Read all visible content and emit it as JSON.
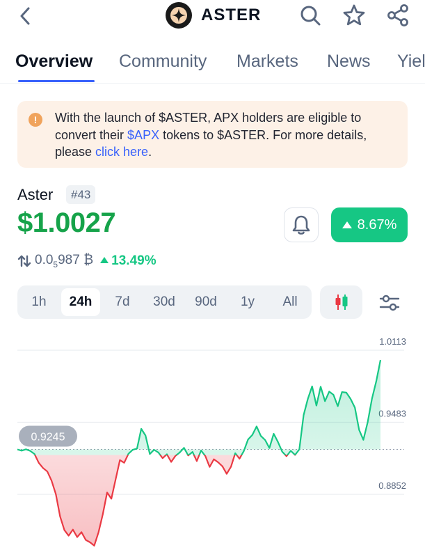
{
  "header": {
    "title": "ASTER",
    "icons": {
      "back": "chevron-left-icon",
      "search": "search-icon",
      "favorite": "star-icon",
      "share": "share-icon"
    }
  },
  "tabs": [
    "Overview",
    "Community",
    "Markets",
    "News",
    "Yiel"
  ],
  "notice": {
    "text_1": "With the launch of $ASTER, APX holders are eligible to convert their ",
    "apx_link": "$APX",
    "text_2": " tokens to $ASTER. For more details, please ",
    "click_link": "click here",
    "text_3": ".",
    "icon": "info-icon"
  },
  "coin": {
    "name": "Aster",
    "rank": "#43",
    "price": "$1.0027",
    "change_24h": "8.67%",
    "btc_price_prefix": "0.0",
    "btc_price_sub": "5",
    "btc_price_rest": "987 ₿",
    "btc_change": "13.49%"
  },
  "ranges": [
    "1h",
    "24h",
    "7d",
    "30d",
    "90d",
    "1y",
    "All"
  ],
  "selected_range": "24h",
  "colors": {
    "up": "#16c784",
    "down": "#ea3943",
    "accent": "#3861fb",
    "notice_bg": "#fdf1e7"
  },
  "chart_data": {
    "type": "line",
    "y_ticks": [
      "1.0113",
      "0.9483",
      "0.8852"
    ],
    "reference_label": "0.9245",
    "reference_value": 0.9245,
    "ylim": [
      0.84,
      1.0113
    ],
    "y": [
      0.9245,
      0.9234,
      0.9246,
      0.9232,
      0.9205,
      0.9128,
      0.9082,
      0.9052,
      0.8972,
      0.8853,
      0.8658,
      0.8539,
      0.849,
      0.8543,
      0.8478,
      0.8521,
      0.8453,
      0.8432,
      0.8403,
      0.8521,
      0.8678,
      0.8868,
      0.8813,
      0.8982,
      0.9152,
      0.9128,
      0.9207,
      0.9241,
      0.9253,
      0.9425,
      0.9367,
      0.9205,
      0.9242,
      0.9218,
      0.9168,
      0.9203,
      0.9135,
      0.9188,
      0.9218,
      0.9259,
      0.9192,
      0.9223,
      0.9143,
      0.9236,
      0.9187,
      0.9092,
      0.9159,
      0.9132,
      0.9097,
      0.9031,
      0.9094,
      0.9212,
      0.9164,
      0.923,
      0.9332,
      0.9372,
      0.9446,
      0.9363,
      0.9327,
      0.9257,
      0.9382,
      0.931,
      0.9224,
      0.9186,
      0.9233,
      0.9197,
      0.9245,
      0.9545,
      0.9688,
      0.9797,
      0.9629,
      0.9794,
      0.9667,
      0.9751,
      0.9723,
      0.9623,
      0.9747,
      0.9742,
      0.9687,
      0.9611,
      0.9416,
      0.9329,
      0.9483,
      0.9687,
      0.9841,
      1.0027
    ]
  }
}
